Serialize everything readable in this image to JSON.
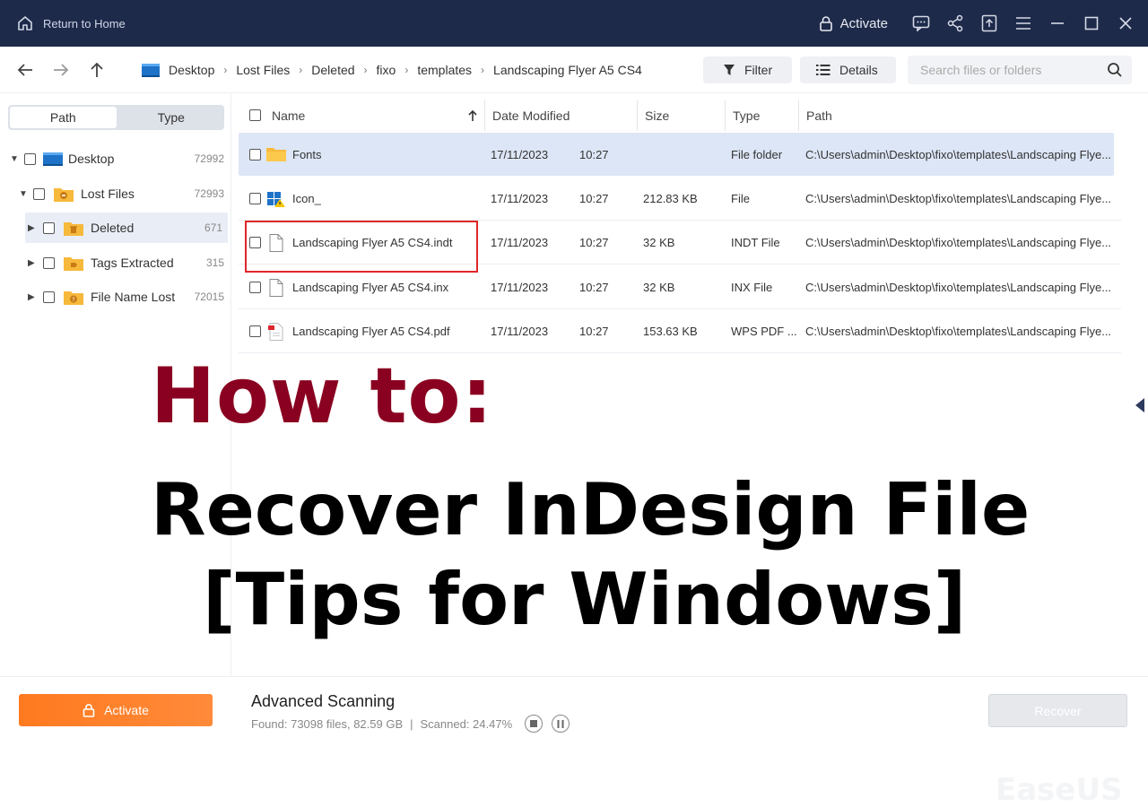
{
  "titlebar": {
    "home_label": "Return to Home",
    "activate_label": "Activate"
  },
  "toolbar": {
    "breadcrumb": [
      "Desktop",
      "Lost Files",
      "Deleted",
      "fixo",
      "templates",
      "Landscaping Flyer A5 CS4"
    ],
    "filter_label": "Filter",
    "details_label": "Details",
    "search_placeholder": "Search files or folders"
  },
  "sidebar": {
    "tab_path": "Path",
    "tab_type": "Type",
    "tree": [
      {
        "label": "Desktop",
        "count": "72992"
      },
      {
        "label": "Lost Files",
        "count": "72993"
      },
      {
        "label": "Deleted",
        "count": "671"
      },
      {
        "label": "Tags Extracted",
        "count": "315"
      },
      {
        "label": "File Name Lost",
        "count": "72015"
      }
    ]
  },
  "table": {
    "headers": {
      "name": "Name",
      "date": "Date Modified",
      "size": "Size",
      "type": "Type",
      "path": "Path"
    },
    "rows": [
      {
        "name": "Fonts",
        "date": "17/11/2023",
        "time": "10:27",
        "size": "",
        "type": "File folder",
        "path": "C:\\Users\\admin\\Desktop\\fixo\\templates\\Landscaping Flye..."
      },
      {
        "name": "Icon_",
        "date": "17/11/2023",
        "time": "10:27",
        "size": "212.83 KB",
        "type": "File",
        "path": "C:\\Users\\admin\\Desktop\\fixo\\templates\\Landscaping Flye..."
      },
      {
        "name": "Landscaping Flyer A5 CS4.indt",
        "date": "17/11/2023",
        "time": "10:27",
        "size": "32 KB",
        "type": "INDT File",
        "path": "C:\\Users\\admin\\Desktop\\fixo\\templates\\Landscaping Flye..."
      },
      {
        "name": "Landscaping Flyer A5 CS4.inx",
        "date": "17/11/2023",
        "time": "10:27",
        "size": "32 KB",
        "type": "INX File",
        "path": "C:\\Users\\admin\\Desktop\\fixo\\templates\\Landscaping Flye..."
      },
      {
        "name": "Landscaping Flyer A5 CS4.pdf",
        "date": "17/11/2023",
        "time": "10:27",
        "size": "153.63 KB",
        "type": "WPS PDF ...",
        "path": "C:\\Users\\admin\\Desktop\\fixo\\templates\\Landscaping Flye..."
      }
    ]
  },
  "overlay": {
    "line1": "How to:",
    "line2": "Recover InDesign File",
    "line3": "[Tips for Windows]"
  },
  "bottom": {
    "activate_label": "Activate",
    "scan_title": "Advanced Scanning",
    "found_text": "Found: 73098 files, 82.59 GB",
    "scanned_text": "Scanned: 24.47%",
    "recover_label": "Recover",
    "watermark": "EaseUS"
  },
  "colors": {
    "titlebar_bg": "#1e2a4a",
    "accent_orange": "#ff7a1f",
    "highlight_red": "#e0262b",
    "overlay_title": "#8a0020"
  }
}
